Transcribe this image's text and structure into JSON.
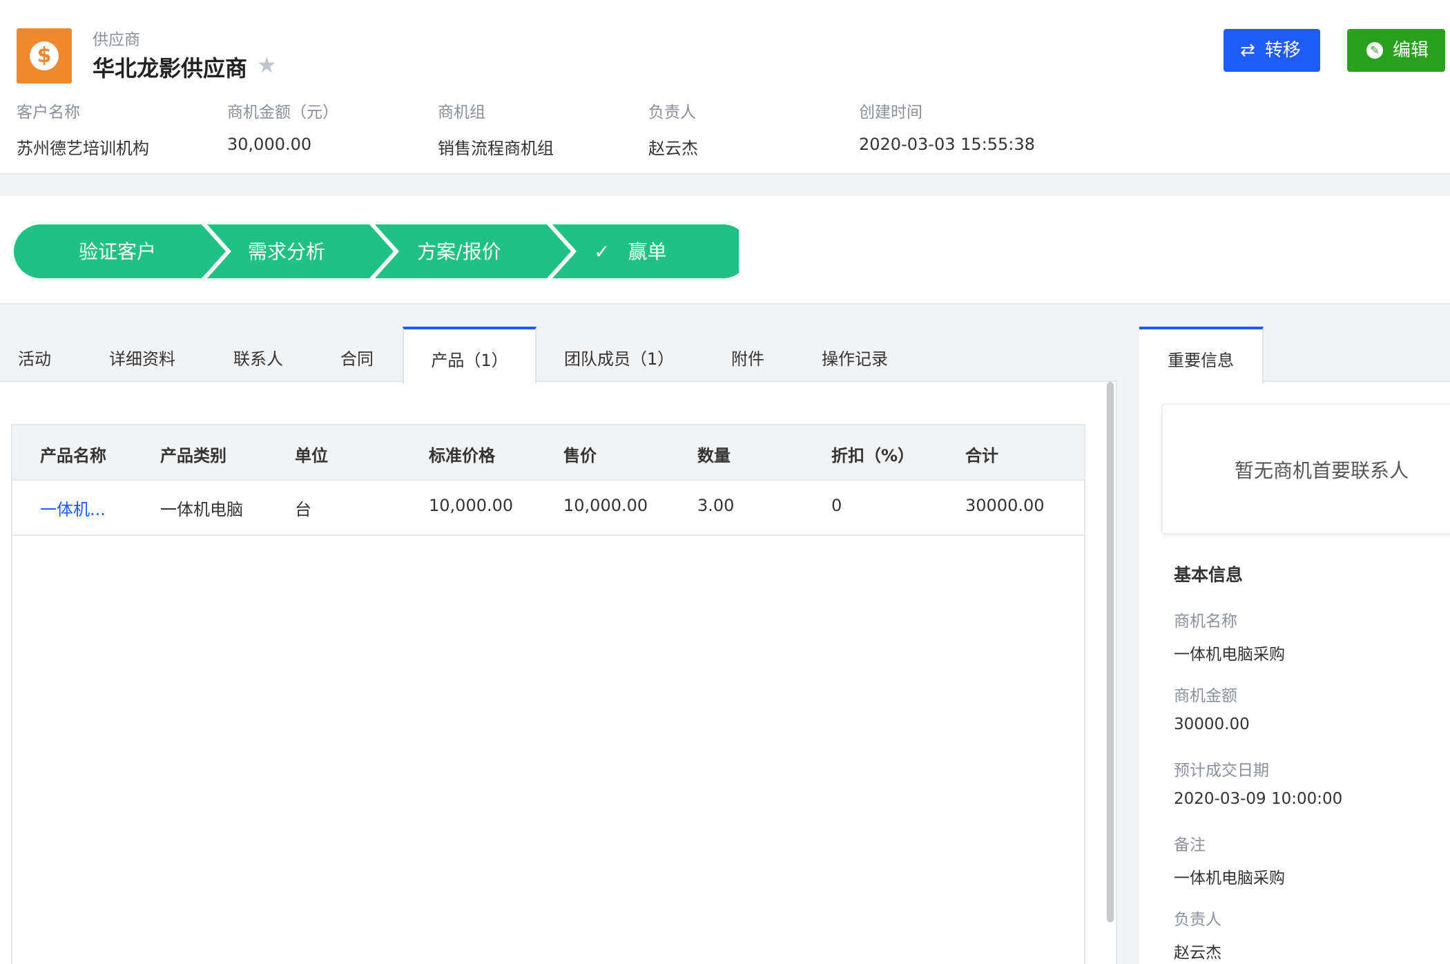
{
  "header": {
    "record_type": "供应商",
    "title": "华北龙影供应商",
    "logo_symbol": "$",
    "star_icon": "star-icon",
    "buttons": {
      "transfer_label": "转移",
      "edit_label": "编辑"
    },
    "colors": {
      "transfer": "#1e5cf5",
      "edit": "#2aa11d",
      "logo": "#f0892d"
    },
    "meta": [
      {
        "label": "客户名称",
        "value": "苏州德艺培训机构"
      },
      {
        "label": "商机金额（元）",
        "value": "30,000.00"
      },
      {
        "label": "商机组",
        "value": "销售流程商机组"
      },
      {
        "label": "负责人",
        "value": "赵云杰"
      },
      {
        "label": "创建时间",
        "value": "2020-03-03 15:55:38"
      }
    ]
  },
  "stages": {
    "color": "#21c084",
    "items": [
      "验证客户",
      "需求分析",
      "方案/报价",
      "赢单"
    ],
    "check_mark": "✓"
  },
  "tabs": [
    "活动",
    "详细资料",
    "联系人",
    "合同",
    "产品（1）",
    "团队成员（1）",
    "附件",
    "操作记录"
  ],
  "active_tab": "产品（1）",
  "product_table": {
    "columns": [
      "产品名称",
      "产品类别",
      "单位",
      "标准价格",
      "售价",
      "数量",
      "折扣（%）",
      "合计"
    ],
    "rows": [
      [
        "一体机...",
        "一体机电脑",
        "台",
        "10,000.00",
        "10,000.00",
        "3.00",
        "0",
        "30000.00"
      ]
    ]
  },
  "right_panel": {
    "tab": "重要信息",
    "contact_empty": "暂无商机首要联系人",
    "section_title": "基本信息",
    "fields": [
      {
        "label": "商机名称",
        "value": "一体机电脑采购"
      },
      {
        "label": "商机金额",
        "value": "30000.00"
      },
      {
        "label": "预计成交日期",
        "value": "2020-03-09 10:00:00"
      },
      {
        "label": "备注",
        "value": "一体机电脑采购"
      },
      {
        "label": "负责人",
        "value": "赵云杰"
      }
    ]
  }
}
